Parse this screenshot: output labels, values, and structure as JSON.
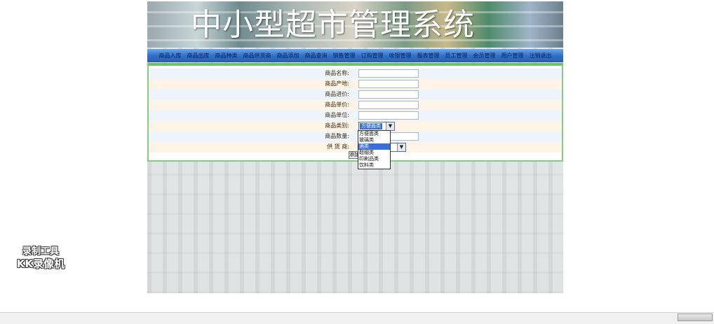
{
  "banner": {
    "title": "中小型超市管理系统"
  },
  "nav": {
    "items": [
      "商品入库",
      "商品出库",
      "商品种类",
      "商品供货商",
      "商品添加",
      "商品查询",
      "销售管理",
      "订购管理",
      "收银管理",
      "报表管理",
      "员工管理",
      "会员管理",
      "用户管理",
      "注销退出"
    ]
  },
  "form": {
    "fields": [
      {
        "label": "商品名称:",
        "value": ""
      },
      {
        "label": "商品产地:",
        "value": ""
      },
      {
        "label": "商品进价:",
        "value": ""
      },
      {
        "label": "商品单价:",
        "value": ""
      },
      {
        "label": "商品单位:",
        "value": ""
      },
      {
        "label": "商品类别:",
        "value": "方便面类"
      },
      {
        "label": "商品数量:",
        "value": ""
      },
      {
        "label": "供 货 商:",
        "value": ""
      }
    ],
    "category_options": [
      "方便面类",
      "玻璃类",
      "酒类",
      "鞋帽类",
      "印刷品类",
      "饮料类"
    ],
    "category_highlighted": "酒类",
    "submit_label": "添加"
  },
  "watermark": {
    "line1": "录制工具",
    "line2": "KK录像机"
  },
  "colors": {
    "nav_bg": "#2f6fc4",
    "form_border": "#6bc26b",
    "selection": "#3a6fd8"
  }
}
